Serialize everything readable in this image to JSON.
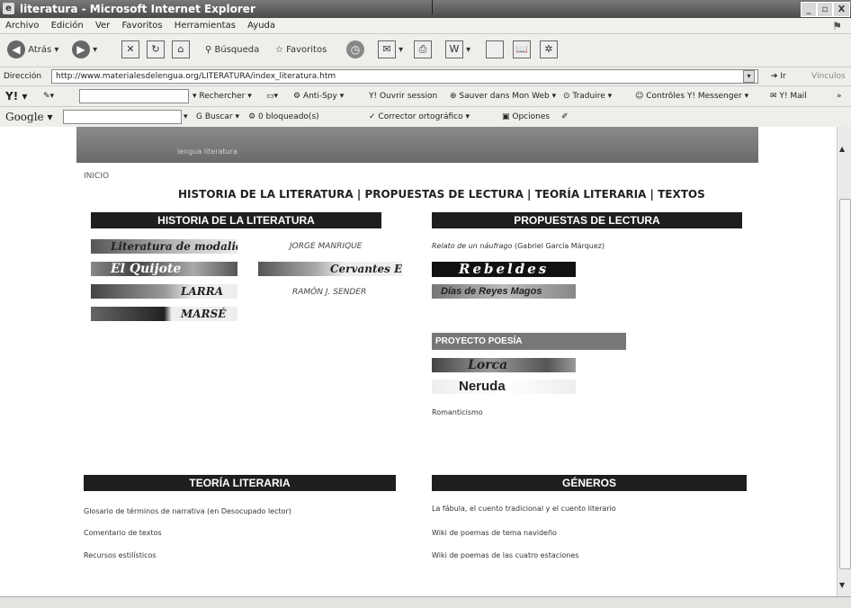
{
  "window": {
    "title": "literatura - Microsoft Internet Explorer",
    "icon": "ie-icon",
    "buttons": [
      "_",
      "▫",
      "X"
    ]
  },
  "menu": [
    "Archivo",
    "Edición",
    "Ver",
    "Favoritos",
    "Herramientas",
    "Ayuda"
  ],
  "toolbar": {
    "back_label": "Atrás",
    "search_label": "Búsqueda",
    "favorites_label": "Favoritos"
  },
  "address": {
    "label": "Dirección",
    "url": "http://www.materialesdelengua.org/LITERATURA/index_literatura.htm",
    "go_label": "Ir",
    "links_label": "Vínculos"
  },
  "yahoo_bar": {
    "search_button": "Rechercher",
    "antispy": "Anti-Spy",
    "open_session": "Ouvrir session",
    "save_web": "Sauver dans Mon Web",
    "translate": "Traduire",
    "messenger": "Contrôles Y! Messenger",
    "mail": "Y! Mail"
  },
  "google_bar": {
    "logo": "Google",
    "search_button": "Buscar",
    "blocked": "0 bloqueado(s)",
    "spellcheck": "Corrector ortográfico",
    "options": "Opciones"
  },
  "page": {
    "banner_text": "lengua literatura",
    "inicio": "INICIO",
    "main_nav": "HISTORIA DE LA LITERATURA | PROPUESTAS DE LECTURA | TEORÍA LITERARIA | TEXTOS",
    "historia": {
      "header": "HISTORIA DE LA LITERATURA",
      "banners": [
        "Literatura de modalidad",
        "El Quijote",
        "LARRA",
        "MARSÉ",
        "Cervantes ESO"
      ],
      "authors": [
        "JORGE MANRIQUE",
        "RAMÓN J. SENDER"
      ]
    },
    "propuestas": {
      "header": "PROPUESTAS DE LECTURA",
      "relato_title": "Relato de un náufrago",
      "relato_author": "(Gabriel García Márquez)",
      "banners": [
        "Rebeldes",
        "Días de Reyes Magos"
      ]
    },
    "poesia": {
      "header": "PROYECTO POESÍA",
      "banners": [
        "Lorca",
        "Neruda"
      ],
      "link": "Romanticismo"
    },
    "teoria": {
      "header": "TEORÍA LITERARIA",
      "links": [
        "Glosario de términos de narrativa (en Desocupado lector)",
        "Comentario de textos",
        "Recursos estilísticos"
      ]
    },
    "generos": {
      "header": "GÉNEROS",
      "links": [
        "La fábula, el cuento tradicional y el cuento literario",
        "Wiki de poemas de tema navideño",
        "Wiki de poemas de las cuatro estaciones"
      ]
    }
  }
}
